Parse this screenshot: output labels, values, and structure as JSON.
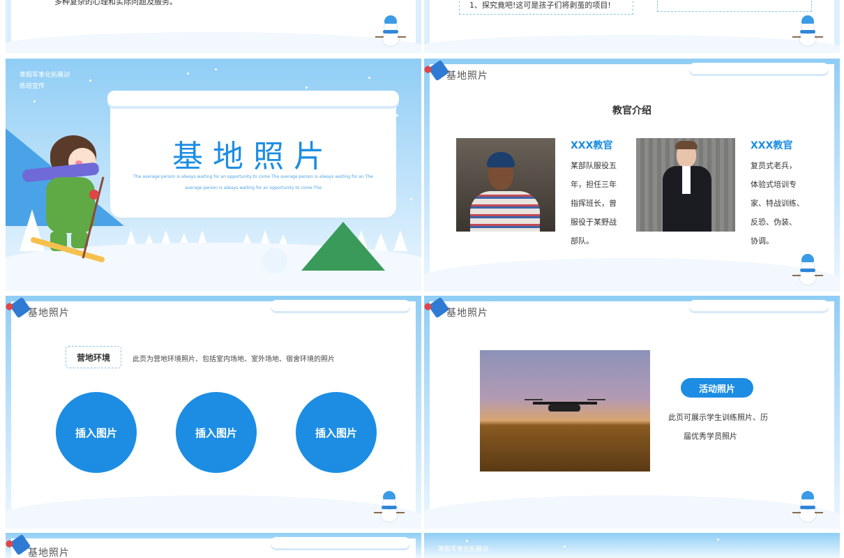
{
  "top_left": {
    "text": "多种复杂的心理和实际问题及服务。"
  },
  "top_right": {
    "list_item": "1、探究竟吧!这可是孩子们将剥茧的项目!"
  },
  "cover": {
    "org_line1": "寒假军事化拓展训",
    "org_line2": "练班宣传",
    "title": "基地照片",
    "subtitle1": "The average person is always waiting for an opportunity to come The average person is always waiting for an The",
    "subtitle2": "average person is always waiting for an opportunity to come The"
  },
  "instructors": {
    "section": "基地照片",
    "heading": "教官介绍",
    "people": [
      {
        "name": "XXX教官",
        "lines": [
          "某部队服役五",
          "年，担任三年",
          "指挥班长，曾",
          "服役于某野战",
          "部队。"
        ]
      },
      {
        "name": "XXX教官",
        "lines": [
          "复员式老兵，",
          "体验式培训专",
          "家、特战训练、",
          "反恐、伪装、",
          "协调。"
        ]
      }
    ]
  },
  "environment": {
    "section": "基地照片",
    "tag": "营地环境",
    "desc": "此页为营地环境照片、包括室内场地、室外场地、宿舍环境的照片",
    "circles": [
      "插入图片",
      "插入图片",
      "插入图片"
    ]
  },
  "activity": {
    "section": "基地照片",
    "tag": "活动照片",
    "line1": "此页可展示学生训练照片、历",
    "line2": "届优秀学员照片"
  },
  "bottom_left": {
    "section": "基地照片"
  },
  "bottom_right": {
    "org_line1": "寒假军事化拓展训"
  },
  "colors": {
    "accent": "#1c8de3",
    "sky": "#8fcdf5"
  }
}
